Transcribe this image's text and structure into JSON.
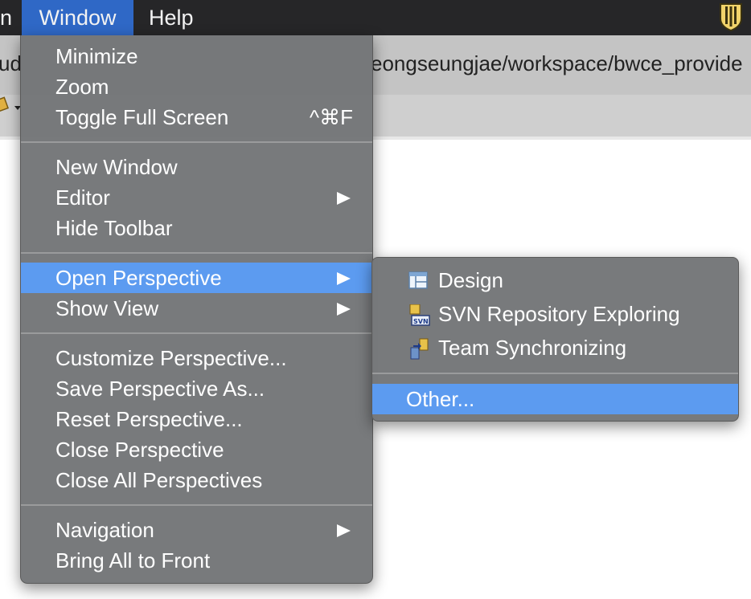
{
  "menubar": {
    "partial_item": "n",
    "window_label": "Window",
    "help_label": "Help"
  },
  "window": {
    "path_left": "ud",
    "path_right": "eongseungjae/workspace/bwce_provide"
  },
  "window_menu": {
    "minimize": "Minimize",
    "zoom": "Zoom",
    "toggle_full_screen": "Toggle Full Screen",
    "toggle_full_screen_shortcut": "^⌘F",
    "new_window": "New Window",
    "editor": "Editor",
    "hide_toolbar": "Hide Toolbar",
    "open_perspective": "Open Perspective",
    "show_view": "Show View",
    "customize_perspective": "Customize Perspective...",
    "save_perspective_as": "Save Perspective As...",
    "reset_perspective": "Reset Perspective...",
    "close_perspective": "Close Perspective",
    "close_all_perspectives": "Close All Perspectives",
    "navigation": "Navigation",
    "bring_all_to_front": "Bring All to Front"
  },
  "perspective_submenu": {
    "design": "Design",
    "design_icon": "design-grid-icon",
    "svn": "SVN Repository Exploring",
    "svn_icon": "svn-repository-icon",
    "team_sync": "Team Synchronizing",
    "team_sync_icon": "team-sync-icon",
    "other": "Other..."
  },
  "colors": {
    "highlight": "#5c9bf0",
    "menubar_active": "#2f68c6",
    "menu_bg": "#747678"
  }
}
